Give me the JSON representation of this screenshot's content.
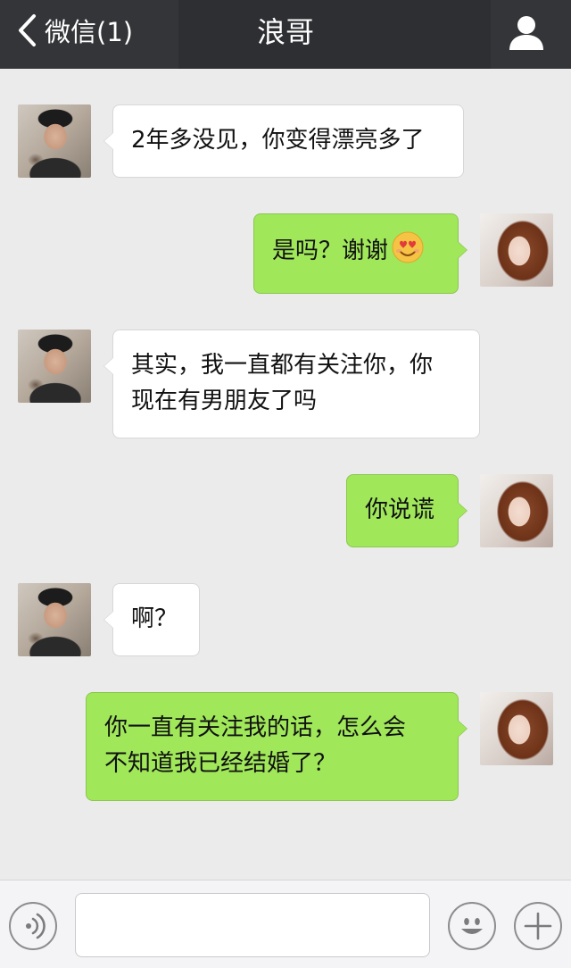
{
  "header": {
    "back_label": "微信(1)",
    "title": "浪哥"
  },
  "messages": [
    {
      "side": "left",
      "text": "2年多没见，你变得漂亮多了"
    },
    {
      "side": "right",
      "text": "是吗？谢谢",
      "emoji": "heart-eyes-emoji"
    },
    {
      "side": "left",
      "text_line1": "其实，我一直都有关注你，你",
      "text_line2": "现在有男朋友了吗"
    },
    {
      "side": "right",
      "text": "你说谎"
    },
    {
      "side": "left",
      "text": "啊？"
    },
    {
      "side": "right",
      "text_line1": "你一直有关注我的话，怎么会",
      "text_line2": "不知道我已经结婚了？"
    }
  ],
  "colors": {
    "header_bg": "#333538",
    "chat_bg": "#ebebeb",
    "bubble_sent": "#a0e75a",
    "bubble_received": "#ffffff"
  },
  "icons": {
    "back": "chevron-left-icon",
    "profile": "person-icon",
    "voice": "voice-icon",
    "emoji": "smiley-icon",
    "more": "plus-icon"
  }
}
